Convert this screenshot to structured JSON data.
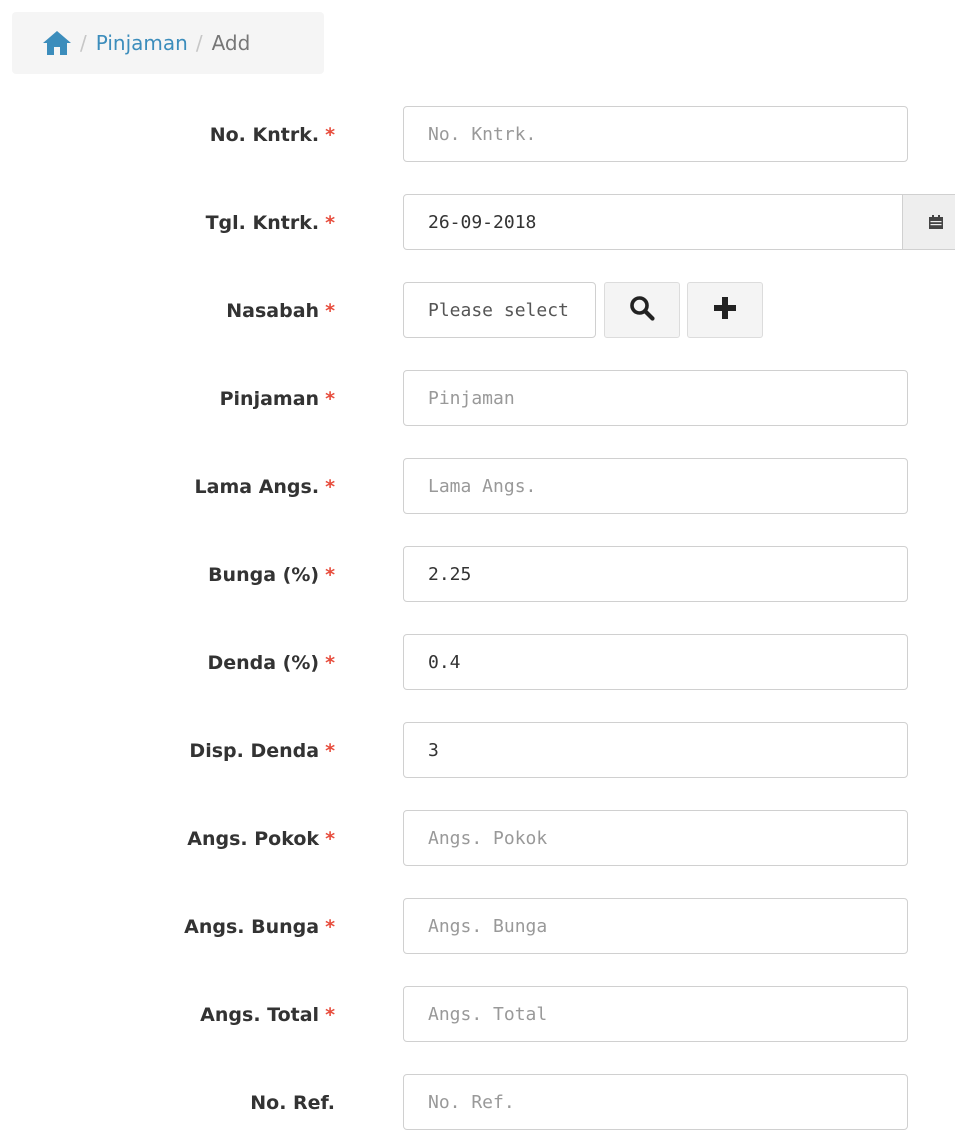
{
  "breadcrumb": {
    "home_icon": "home-icon",
    "separator": "/",
    "items": [
      "Pinjaman",
      "Add"
    ]
  },
  "colors": {
    "link": "#3c8dbc",
    "required": "#e74c3c"
  },
  "form": {
    "required_mark": "*",
    "no_kontrak": {
      "label": "No. Kntrk.",
      "value": "",
      "placeholder": "No. Kntrk."
    },
    "tgl_kontrak": {
      "label": "Tgl. Kntrk.",
      "value": "26-09-2018",
      "icon": "calendar-icon"
    },
    "nasabah": {
      "label": "Nasabah",
      "value": "Please select",
      "search_icon": "search-icon",
      "add_icon": "plus-icon"
    },
    "pinjaman": {
      "label": "Pinjaman",
      "value": "",
      "placeholder": "Pinjaman"
    },
    "lama_angs": {
      "label": "Lama Angs.",
      "value": "",
      "placeholder": "Lama Angs."
    },
    "bunga": {
      "label": "Bunga (%)",
      "value": "2.25"
    },
    "denda": {
      "label": "Denda (%)",
      "value": "0.4"
    },
    "disp_denda": {
      "label": "Disp. Denda",
      "value": "3"
    },
    "angs_pokok": {
      "label": "Angs. Pokok",
      "value": "",
      "placeholder": "Angs. Pokok"
    },
    "angs_bunga": {
      "label": "Angs. Bunga",
      "value": "",
      "placeholder": "Angs. Bunga"
    },
    "angs_total": {
      "label": "Angs. Total",
      "value": "",
      "placeholder": "Angs. Total"
    },
    "no_ref": {
      "label": "No. Ref.",
      "value": "",
      "placeholder": "No. Ref."
    }
  }
}
